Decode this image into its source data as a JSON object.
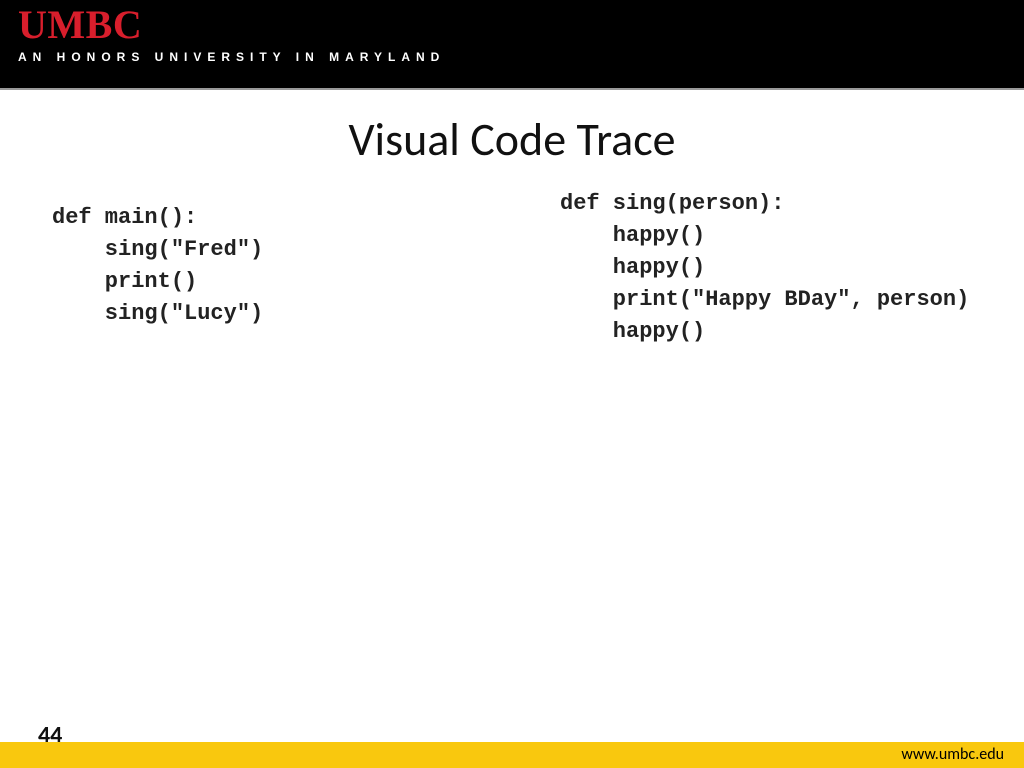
{
  "header": {
    "logo": "UMBC",
    "tagline": "AN HONORS UNIVERSITY IN MARYLAND"
  },
  "title": "Visual Code Trace",
  "code": {
    "left": "def main():\n    sing(\"Fred\")\n    print()\n    sing(\"Lucy\")",
    "right": "def sing(person):\n    happy()\n    happy()\n    print(\"Happy BDay\", person)\n    happy()"
  },
  "footer": {
    "page": "44",
    "url": "www.umbc.edu"
  }
}
